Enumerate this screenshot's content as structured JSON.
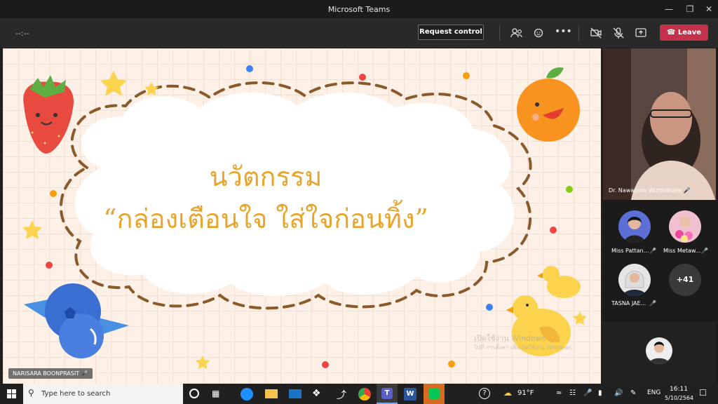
{
  "window": {
    "title": "Microsoft Teams"
  },
  "toolbar": {
    "timer": "--:--",
    "request_control": "Request control",
    "leave": "Leave"
  },
  "slide": {
    "title_line1": "นวัตกรรม",
    "title_line2": "“กล่องเตือนใจ  ใส่ใจก่อนทิ้ง”",
    "watermark_line1": "เปิดใช้งาน Windows",
    "watermark_line2": "ไปที่ การตั้งค่า เพื่อเปิดใช้งาน Windows"
  },
  "presenter": {
    "name": "NARISARA BOONPRASIT"
  },
  "participants": {
    "main": {
      "name": "Dr. Nawaporn Wutthitham"
    },
    "tiles": [
      {
        "name": "Miss Pattan..."
      },
      {
        "name": "Miss Metaw..."
      },
      {
        "name": "TASNA JAE..."
      }
    ],
    "more_count": "+41"
  },
  "taskbar": {
    "search_placeholder": "Type here to search",
    "weather": "91°F",
    "language": "ENG",
    "time": "16:11",
    "date": "5/10/2564"
  }
}
